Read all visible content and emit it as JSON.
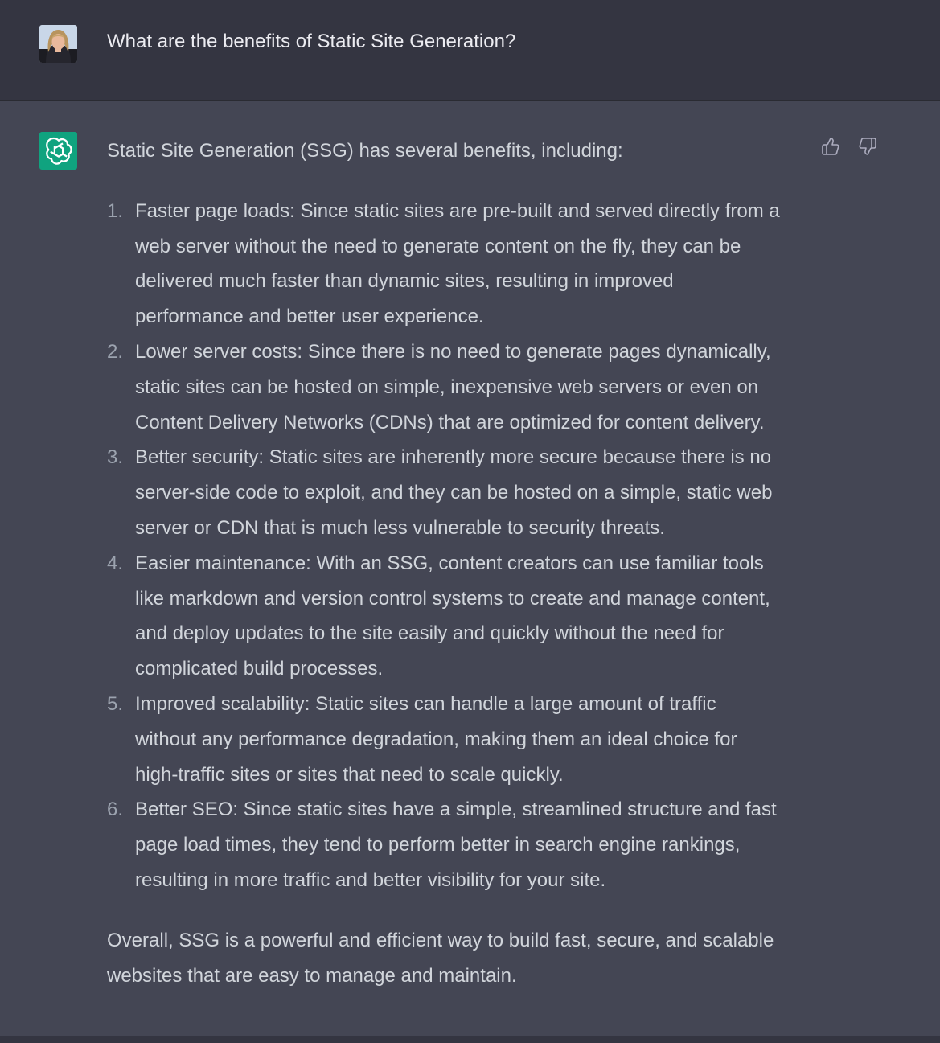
{
  "user_message": {
    "text": "What are the benefits of Static Site Generation?"
  },
  "assistant_message": {
    "intro": "Static Site Generation (SSG) has several benefits, including:",
    "items": [
      {
        "number": "1.",
        "lines": [
          "Faster page loads: Since static sites are pre-built and served directly from a",
          "web server without the need to generate content on the fly, they can be",
          "delivered much faster than dynamic sites, resulting in improved",
          "performance and better user experience."
        ]
      },
      {
        "number": "2.",
        "lines": [
          "Lower server costs: Since there is no need to generate pages dynamically,",
          "static sites can be hosted on simple, inexpensive web servers or even on",
          "Content Delivery Networks (CDNs) that are optimized for content delivery."
        ]
      },
      {
        "number": "3.",
        "lines": [
          "Better security: Static sites are inherently more secure because there is no",
          "server-side code to exploit, and they can be hosted on a simple, static web",
          "server or CDN that is much less vulnerable to security threats."
        ]
      },
      {
        "number": "4.",
        "lines": [
          "Easier maintenance: With an SSG, content creators can use familiar tools",
          "like markdown and version control systems to create and manage content,",
          "and deploy updates to the site easily and quickly without the need for",
          "complicated build processes."
        ]
      },
      {
        "number": "5.",
        "lines": [
          "Improved scalability: Static sites can handle a large amount of traffic",
          "without any performance degradation, making them an ideal choice for",
          "high-traffic sites or sites that need to scale quickly."
        ]
      },
      {
        "number": "6.",
        "lines": [
          "Better SEO: Since static sites have a simple, streamlined structure and fast",
          "page load times, they tend to perform better in search engine rankings,",
          "resulting in more traffic and better visibility for your site."
        ]
      }
    ],
    "conclusion_lines": [
      "Overall, SSG is a powerful and efficient way to build fast, secure, and scalable",
      "websites that are easy to manage and maintain."
    ]
  },
  "icons": {
    "user_avatar": "user-photo-avatar",
    "assistant_avatar": "openai-logo-icon",
    "thumbs_up": "thumbs-up-icon",
    "thumbs_down": "thumbs-down-icon"
  },
  "colors": {
    "user_row_bg": "#343541",
    "assistant_row_bg": "#444654",
    "assistant_avatar_bg": "#10a37f",
    "text": "#d1d5db"
  }
}
